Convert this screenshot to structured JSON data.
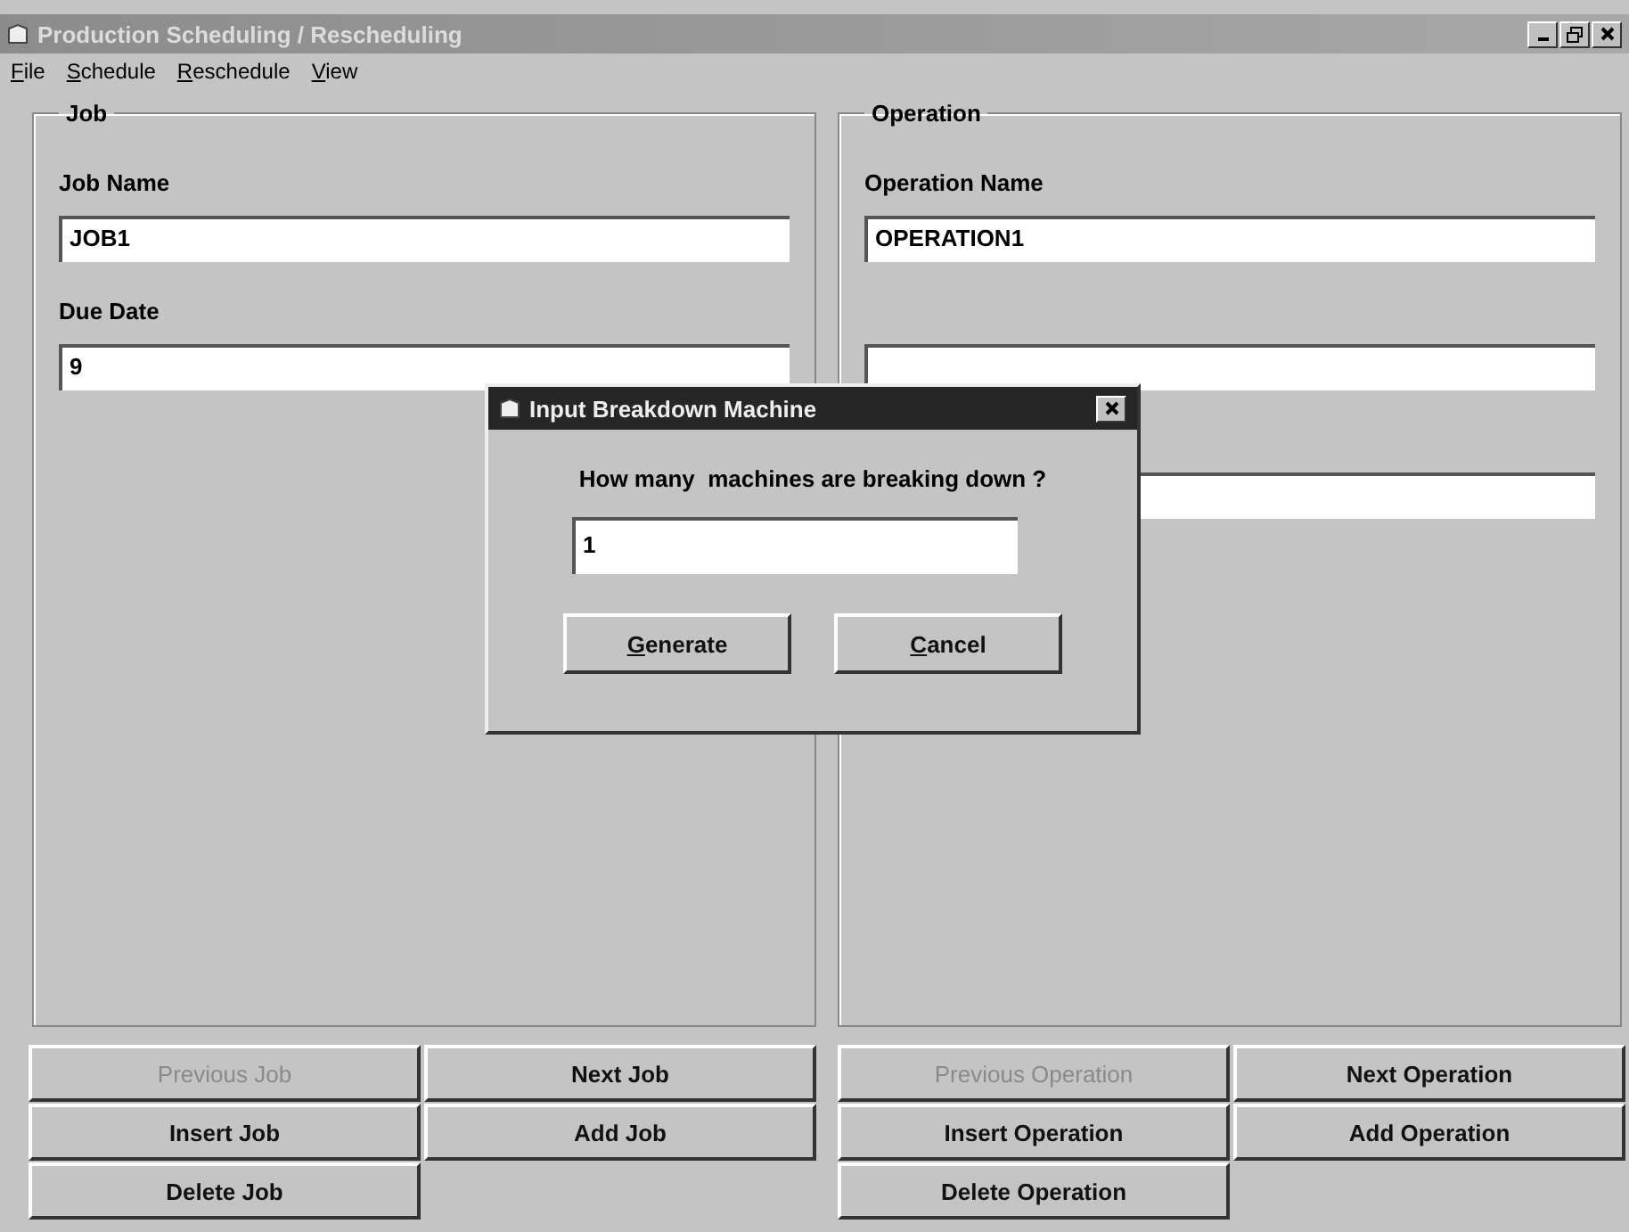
{
  "window": {
    "title": "Production Scheduling / Rescheduling",
    "active": false
  },
  "menu": [
    {
      "label": "File"
    },
    {
      "label": "Schedule"
    },
    {
      "label": "Reschedule"
    },
    {
      "label": "View"
    }
  ],
  "job": {
    "title": "Job",
    "fields": [
      {
        "kind": "text",
        "label": "Job Name",
        "value": "JOB1"
      },
      {
        "kind": "text",
        "label": "Due Date",
        "value": "9"
      }
    ]
  },
  "operation": {
    "title": "Operation",
    "fields": [
      {
        "kind": "text",
        "label": "Operation Name",
        "value": "OPERATION1"
      },
      {
        "kind": "text"
      },
      {
        "kind": "text"
      }
    ]
  },
  "job_buttons": [
    {
      "label": "Previous Job",
      "disabled": true
    },
    {
      "label": "Next Job",
      "disabled": false
    },
    {
      "label": "Insert Job",
      "disabled": false
    },
    {
      "label": "Add Job",
      "disabled": false
    },
    {
      "label": "Delete Job",
      "disabled": false
    }
  ],
  "operation_buttons": [
    {
      "label": "Previous Operation",
      "disabled": true
    },
    {
      "label": "Next Operation",
      "disabled": false
    },
    {
      "label": "Insert Operation",
      "disabled": false
    },
    {
      "label": "Add Operation",
      "disabled": false
    },
    {
      "label": "Delete Operation",
      "disabled": false
    }
  ],
  "dialog": {
    "title": "Input Breakdown Machine",
    "active": true,
    "prompt": "How many  machines are breaking down ?",
    "value": "1",
    "buttons": [
      "Generate",
      "Cancel"
    ]
  }
}
